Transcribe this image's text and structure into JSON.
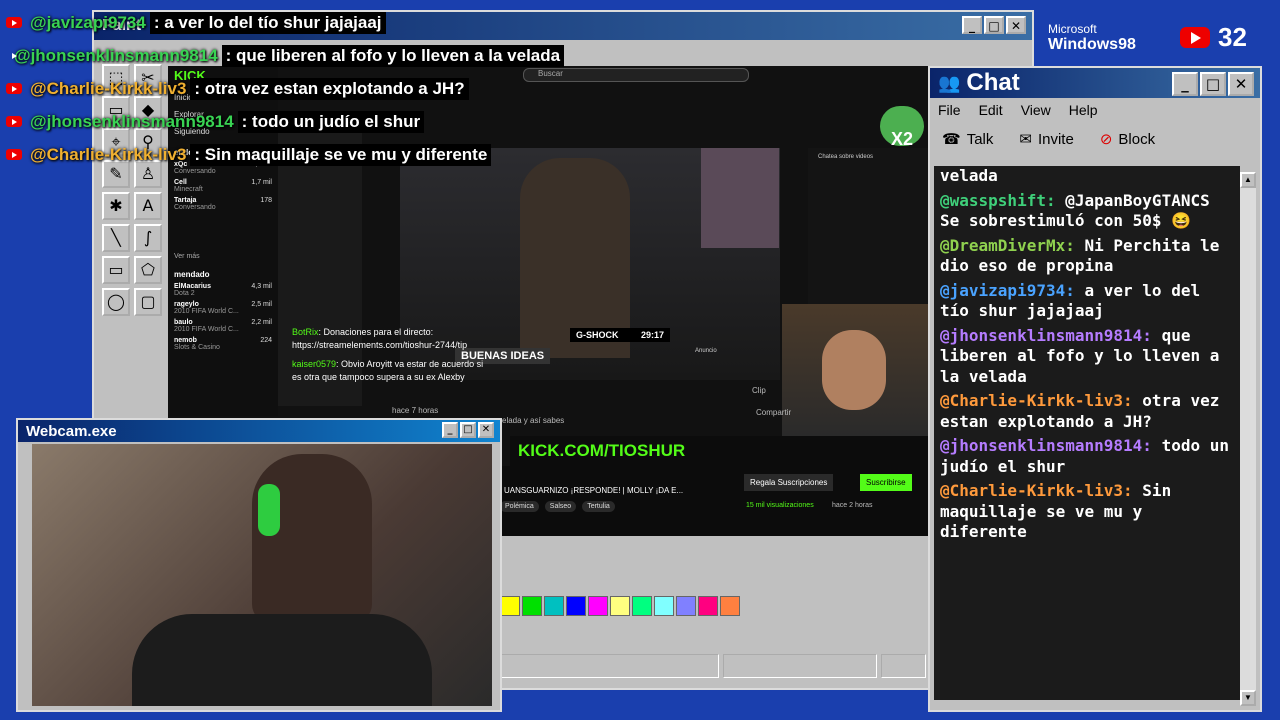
{
  "paint": {
    "title": "Paint"
  },
  "browser": {
    "kick_logo": "KICK",
    "search_placeholder": "Buscar",
    "nav": [
      "Inicio",
      "Explorar",
      "Siguiendo"
    ],
    "sidebar_section": "endo",
    "sidebar_channels": [
      {
        "name": "xQc",
        "sub": "Conversando",
        "count": "6,2 mil"
      },
      {
        "name": "Cell",
        "sub": "Minecraft",
        "count": "1,7 mil"
      },
      {
        "name": "Tartaja",
        "sub": "Conversando",
        "count": "178"
      }
    ],
    "sidebar_more": "Ver más",
    "recommended_label": "mendado",
    "recommended": [
      {
        "name": "ElMacarius",
        "sub": "Dota 2",
        "count": "4,3 mil"
      },
      {
        "name": "rageylo",
        "sub": "2010 FIFA World C...",
        "count": "2,5 mil"
      },
      {
        "name": "baulo",
        "sub": "2010 FIFA World C...",
        "count": "2,2 mil"
      },
      {
        "name": "nemob",
        "sub": "Slots & Casino",
        "count": "224"
      }
    ],
    "video_overlay": {
      "gshock": "G-SHOCK",
      "timer": "29:17",
      "banner": "BUENAS IDEAS",
      "anuncio": "Anuncio"
    },
    "kick_banner": "KICK.COM/TIOSHUR",
    "stream_title": "UANSGUARNIZO ¡RESPONDE! | MOLLY ¡DA E...",
    "tags": [
      "Polémica",
      "Salseo",
      "Tertulia"
    ],
    "views": "15 mil visualizaciones",
    "ago": "hace 2 horas",
    "subs_button": "Regala Suscripciones",
    "subscribe_button": "Suscribirse",
    "inner_chat_title": "Chatea sobre videos",
    "bot_msg": {
      "user": "BotRix",
      "text": "Donaciones para el directo: https://streamelements.com/tioshur-2744/tip"
    },
    "kaiser_msg": {
      "user": "kaiser0579",
      "text": "Obvio Aroyitt va estar de acuerdo si es otra que tampoco supera a su ex Alexby"
    },
    "hace_7": "hace 7 horas",
    "velada_text": "velada y así sabes",
    "compartir": "Compartir",
    "clip": "Clip",
    "x2": "X2"
  },
  "palette": [
    "#ffff00",
    "#00e000",
    "#00c0c0",
    "#0000ff",
    "#ff00ff",
    "#ffff80",
    "#00ff80",
    "#80ffff",
    "#8080ff",
    "#ff0080",
    "#ff8040"
  ],
  "overlay_chat": [
    {
      "user": "@javizapi9734",
      "color": "#39d353",
      "text": ": a ver lo del tío shur jajajaaj"
    },
    {
      "user": "@jhonsenklinsmann9814",
      "color": "#39d353",
      "text": ": que liberen al fofo y lo lleven a la velada"
    },
    {
      "user": "@Charlie-Kirkk-liv3",
      "color": "#f0b030",
      "text": ": otra vez estan explotando a JH?"
    },
    {
      "user": "@jhonsenklinsmann9814",
      "color": "#39d353",
      "text": ": todo un judío el shur"
    },
    {
      "user": "@Charlie-Kirkk-liv3",
      "color": "#f0b030",
      "text": ": Sin maquillaje se ve mu y diferente"
    }
  ],
  "win98_logo": {
    "line1": "Microsoft",
    "line2": "Windows98"
  },
  "counter": "32",
  "chat_window": {
    "title": "Chat",
    "menu": [
      "File",
      "Edit",
      "View",
      "Help"
    ],
    "toolbar": [
      "Talk",
      "Invite",
      "Block"
    ],
    "messages": [
      {
        "user": "",
        "text": "velada",
        "color": "#ffffff"
      },
      {
        "user": "@wasspshift:",
        "text": "@JapanBoyGTANCS Se sobrestimuló con 50$ 😆",
        "color": "#3fd07a"
      },
      {
        "user": "@DreamDiverMx:",
        "text": "Ni Perchita le dio eso de propina",
        "color": "#8fd14f"
      },
      {
        "user": "@javizapi9734:",
        "text": "a ver lo del tío shur jajajaaj",
        "color": "#4aa3ff"
      },
      {
        "user": "@jhonsenklinsmann9814:",
        "text": "que liberen al fofo y lo lleven a la velada",
        "color": "#b57cff"
      },
      {
        "user": "@Charlie-Kirkk-liv3:",
        "text": "otra vez estan explotando a JH?",
        "color": "#ff9a3c"
      },
      {
        "user": "@jhonsenklinsmann9814:",
        "text": "todo un judío el shur",
        "color": "#b57cff"
      },
      {
        "user": "@Charlie-Kirkk-liv3:",
        "text": "Sin maquillaje se ve mu y diferente",
        "color": "#ff9a3c"
      }
    ]
  },
  "webcam": {
    "title": "Webcam.exe"
  }
}
